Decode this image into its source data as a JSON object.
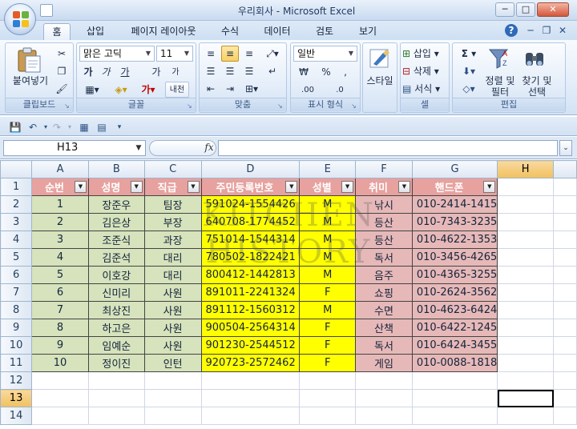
{
  "window": {
    "title": "우리회사 - Microsoft Excel",
    "controls": [
      "─",
      "□",
      "✕"
    ]
  },
  "ribbon_tabs": [
    "홈",
    "삽입",
    "페이지 레이아웃",
    "수식",
    "데이터",
    "검토",
    "보기"
  ],
  "ribbon_right": {
    "help": "?",
    "min": "─",
    "restore": "❐",
    "close": "✕"
  },
  "clipboard": {
    "paste_label_1": "붙여넣기",
    "group_label": "클립보드"
  },
  "font": {
    "font_name": "맑은 고딕",
    "font_size": "11",
    "bold": "가",
    "italic": "가",
    "underline": "가",
    "grow": "가",
    "shrink": "가",
    "phonetic": "내천",
    "font_color_glyph": "가",
    "group_label": "글꼴"
  },
  "alignment": {
    "group_label": "맞춤"
  },
  "number": {
    "format": "일반",
    "currency": "₩",
    "percent": "%",
    "comma": ",",
    "inc_dec": ".00",
    "dec_dec": ".0",
    "group_label": "표시 형식"
  },
  "styles": {
    "label": "스타일"
  },
  "cells": {
    "insert": "삽입",
    "delete": "삭제",
    "format": "서식",
    "group_label": "셀"
  },
  "editing": {
    "sigma": "Σ",
    "sort_label_1": "정렬 및",
    "sort_label_2": "필터",
    "find_label_1": "찾기 및",
    "find_label_2": "선택",
    "group_label": "편집"
  },
  "namebox": {
    "value": "H13"
  },
  "formula": {
    "fx": "fx",
    "value": ""
  },
  "columns": [
    "A",
    "B",
    "C",
    "D",
    "E",
    "F",
    "G",
    "H"
  ],
  "selected_column": "H",
  "selected_row": 13,
  "rows": [
    1,
    2,
    3,
    4,
    5,
    6,
    7,
    8,
    9,
    10,
    11,
    12,
    13,
    14
  ],
  "table": {
    "headers": [
      "순번",
      "성명",
      "직급",
      "주민등록번호",
      "성별",
      "취미",
      "핸드폰"
    ],
    "records": [
      [
        "1",
        "장준우",
        "팀장",
        "591024-1554426",
        "M",
        "낚시",
        "010-2414-1415"
      ],
      [
        "2",
        "김은상",
        "부장",
        "640708-1774452",
        "M",
        "등산",
        "010-7343-3235"
      ],
      [
        "3",
        "조준식",
        "과장",
        "751014-1544314",
        "M",
        "등산",
        "010-4622-1353"
      ],
      [
        "4",
        "김준석",
        "대리",
        "780502-1822421",
        "M",
        "독서",
        "010-3456-4265"
      ],
      [
        "5",
        "이호강",
        "대리",
        "800412-1442813",
        "M",
        "음주",
        "010-4365-3255"
      ],
      [
        "6",
        "신미리",
        "사원",
        "891011-2241324",
        "F",
        "쇼핑",
        "010-2624-3562"
      ],
      [
        "7",
        "최상진",
        "사원",
        "891112-1560312",
        "M",
        "수면",
        "010-4623-6424"
      ],
      [
        "8",
        "하고은",
        "사원",
        "900504-2564314",
        "F",
        "산책",
        "010-6422-1245"
      ],
      [
        "9",
        "임예순",
        "사원",
        "901230-2544512",
        "F",
        "독서",
        "010-6424-3455"
      ],
      [
        "10",
        "정이진",
        "인턴",
        "920723-2572462",
        "F",
        "게임",
        "010-0088-1818"
      ]
    ]
  },
  "watermark": "KITCHEN HISTORY",
  "colors": {
    "header_fill": "#e7a19e",
    "green_fill": "#d6e3bc",
    "yellow_fill": "#ffff00",
    "pink_fill": "#e6b9b8",
    "selection_header": "#f8cf62"
  }
}
